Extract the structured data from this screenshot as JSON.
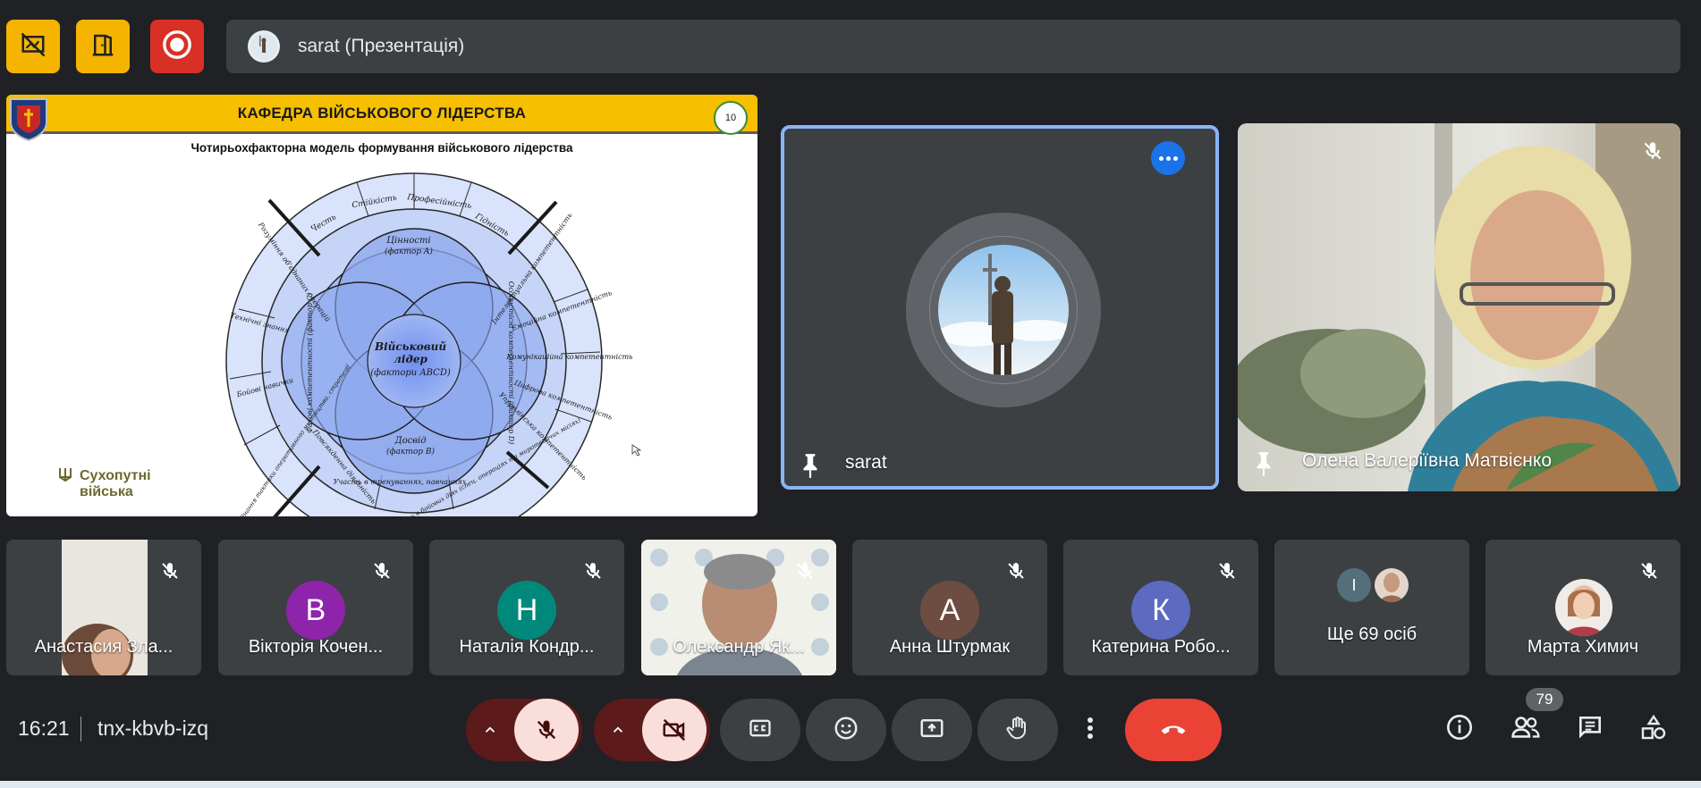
{
  "top_bar": {
    "presenting_label": "sarat (Презентація)"
  },
  "slide": {
    "header": "КАФЕДРА ВІЙСЬКОВОГО ЛІДЕРСТВА",
    "page_number": "10",
    "subtitle": "Чотирьохфакторна модель формування військового лідерства",
    "brand_line1": "Сухопутні",
    "brand_line2": "війська",
    "center_line1": "Військовий",
    "center_line2": "лідер",
    "center_line3": "(фактори ABCD)",
    "factor_a_1": "Цінності",
    "factor_a_2": "(фактор A)",
    "factor_b_1": "Досвід",
    "factor_b_2": "(фактор B)",
    "factor_c": "Фахові компетентності (фактор C)",
    "factor_d": "Особистісні компетентності (фактор D)",
    "outer_top": [
      "Честь",
      "Стійкість",
      "Професійність",
      "Гідність"
    ],
    "outer_right": [
      "Інтелектуальна компетентність",
      "Емоційна компетентність",
      "Комунікаційна компетентність",
      "Цифрова компетентність",
      "Управлінська компетентність"
    ],
    "outer_bottom": [
      "Повсякденна діяльність",
      "Участь в тренуваннях, навчаннях",
      "Участь в бойових діях (спец. операціях та миротворчих місіях)"
    ],
    "outer_left": [
      "Розуміння об'єднаних операцій",
      "Технічні знання",
      "Бойові навички",
      "Знання тактики оперативного мистецтва, стратегії"
    ]
  },
  "tiles": {
    "sarat_name": "sarat",
    "olena_name": "Олена Валеріївна Матвієнко"
  },
  "participants": [
    {
      "name": "Анастасия Зла...",
      "initial": "",
      "color": ""
    },
    {
      "name": "Вікторія Кочен...",
      "initial": "В",
      "color": "#8e24aa"
    },
    {
      "name": "Наталія Кондр...",
      "initial": "Н",
      "color": "#00897b"
    },
    {
      "name": "Олександр Як...",
      "initial": "",
      "color": ""
    },
    {
      "name": "Анна Штурмак",
      "initial": "А",
      "color": "#6d4c41"
    },
    {
      "name": "Катерина Робо...",
      "initial": "К",
      "color": "#5c6bc0"
    },
    {
      "name": "Ще 69 осіб",
      "initial": "I",
      "color": "#546e7a"
    },
    {
      "name": "Марта Химич",
      "initial": "",
      "color": ""
    }
  ],
  "bottom_bar": {
    "time": "16:21",
    "meeting_code": "tnx-kbvb-izq",
    "participant_count": "79"
  },
  "colors": {
    "background": "#202124",
    "tile": "#3c4043",
    "active_border": "#8ab4f8",
    "end_call": "#ea4335",
    "presenter_yellow": "#f5b400"
  }
}
